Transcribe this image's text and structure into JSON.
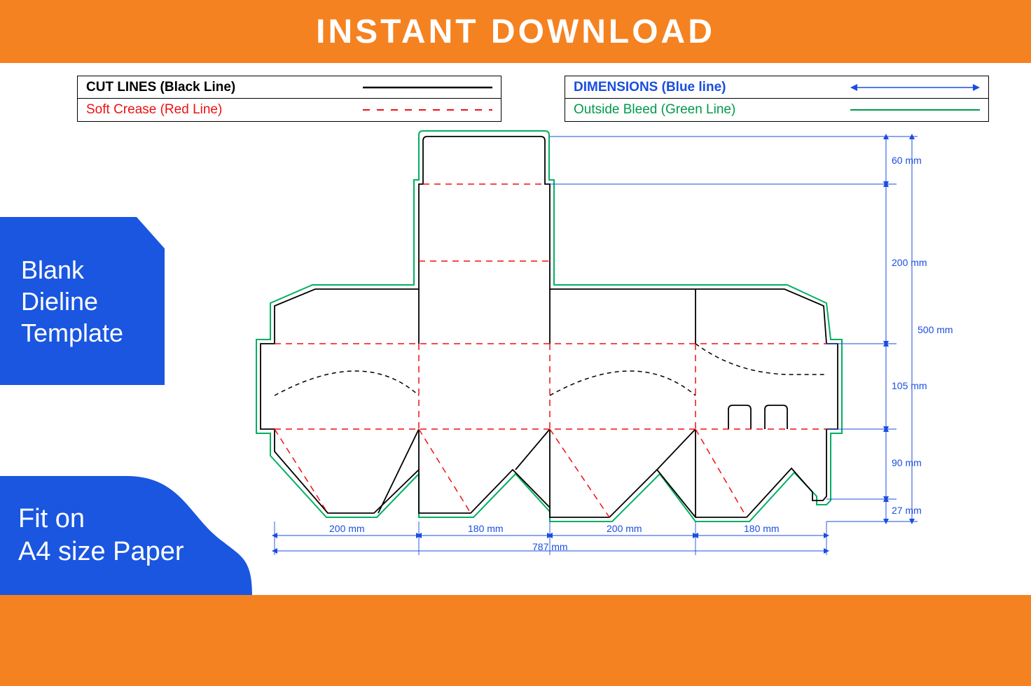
{
  "banner_top": "INSTANT DOWNLOAD",
  "badge1_line1": "Blank",
  "badge1_line2": "Dieline",
  "badge1_line3": "Template",
  "badge2_line1": "Fit on",
  "badge2_line2": "A4 size Paper",
  "legend": {
    "cut": "CUT LINES (Black Line)",
    "crease": "Soft Crease (Red Line)",
    "dim": "DIMENSIONS (Blue line)",
    "bleed": "Outside Bleed (Green Line)"
  },
  "dimensions": {
    "h_60": "60 mm",
    "h_200": "200 mm",
    "h_105": "105 mm",
    "h_90": "90 mm",
    "h_27": "27 mm",
    "h_500": "500 mm",
    "w_200a": "200 mm",
    "w_180a": "180 mm",
    "w_200b": "200 mm",
    "w_180b": "180 mm",
    "w_787": "787 mm"
  }
}
